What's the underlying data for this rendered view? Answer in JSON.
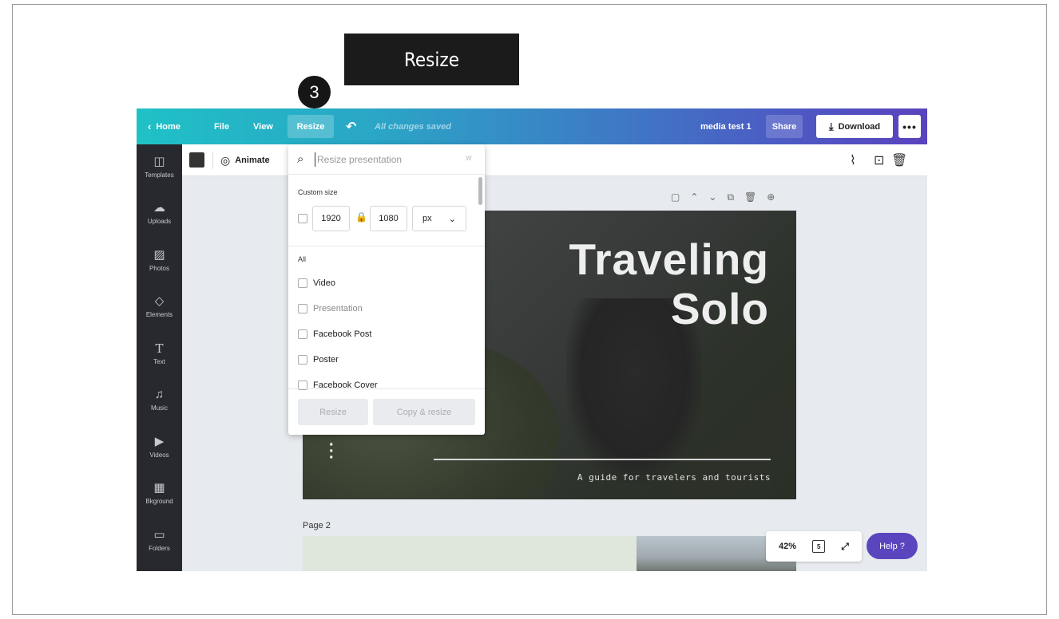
{
  "callout": {
    "label": "Resize",
    "step": "3"
  },
  "topbar": {
    "home": "Home",
    "file": "File",
    "view": "View",
    "resize": "Resize",
    "saved_status": "All changes saved",
    "design_title": "media test 1",
    "share": "Share",
    "download": "Download",
    "more": "•••"
  },
  "sidebar": {
    "items": [
      {
        "label": "Templates",
        "icon": "templates-icon"
      },
      {
        "label": "Uploads",
        "icon": "uploads-icon"
      },
      {
        "label": "Photos",
        "icon": "photos-icon"
      },
      {
        "label": "Elements",
        "icon": "elements-icon"
      },
      {
        "label": "Text",
        "icon": "text-icon"
      },
      {
        "label": "Music",
        "icon": "music-icon"
      },
      {
        "label": "Videos",
        "icon": "videos-icon"
      },
      {
        "label": "Bkground",
        "icon": "background-icon"
      },
      {
        "label": "Folders",
        "icon": "folders-icon"
      }
    ]
  },
  "toolbar": {
    "animate": "Animate",
    "swatch_color": "#333333"
  },
  "resize_panel": {
    "search_placeholder": "Resize presentation",
    "kbd_hint": "W",
    "custom_size_label": "Custom size",
    "width": "1920",
    "height": "1080",
    "unit": "px",
    "all_label": "All",
    "options": [
      {
        "label": "Video",
        "dim": false
      },
      {
        "label": "Presentation",
        "dim": true
      },
      {
        "label": "Facebook Post",
        "dim": false
      },
      {
        "label": "Poster",
        "dim": false
      },
      {
        "label": "Facebook Cover",
        "dim": false
      }
    ],
    "resize_button": "Resize",
    "copy_resize_button": "Copy & resize"
  },
  "slide": {
    "title_line1": "Traveling",
    "title_line2": "Solo",
    "subtitle": "A guide for travelers and tourists"
  },
  "page2_label": "Page 2",
  "zoom": {
    "level": "42%",
    "page_count": "5"
  },
  "help": "Help ?",
  "colors": {
    "topbar_start": "#1fc1c6",
    "topbar_end": "#5a43be",
    "sidebar": "#27292f",
    "help": "#5a45bf"
  }
}
